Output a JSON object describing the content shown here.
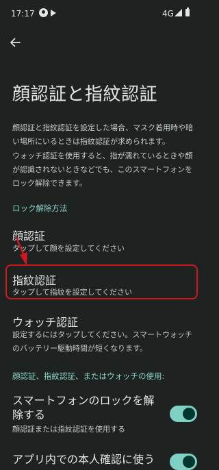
{
  "status_bar": {
    "time": "17:17",
    "network": "4G"
  },
  "page": {
    "title": "顔認証と指紋認証",
    "description_1": "顔認証と指紋認証を設定した場合、マスク着用時や暗い場所にいるときは指紋認証が求められます。",
    "description_2": "ウォッチ認証を使用すると、指が濡れているときや顔が認識されないときなどでも、このスマートフォンをロック解除できます。"
  },
  "unlock_methods": {
    "header": "ロック解除方法",
    "face": {
      "title": "顔認証",
      "subtitle": "タップして顔を設定してください"
    },
    "fingerprint": {
      "title": "指紋認証",
      "subtitle": "タップして指紋を設定してください"
    },
    "watch": {
      "title": "ウォッチ認証",
      "subtitle": "設定するにはタップしてください。スマートウォッチのバッテリー駆動時間が短くなります。"
    }
  },
  "usage": {
    "header": "顔認証、指紋認証、またはウォッチの使用:",
    "unlock_phone": {
      "title": "スマートフォンのロックを解除する",
      "subtitle": "顔認証または指紋認証を使用する",
      "enabled": true
    },
    "in_app": {
      "title": "アプリ内での本人確認に使う",
      "enabled": true
    }
  },
  "colors": {
    "background": "#1e2322",
    "accent": "#8bd3c6",
    "toggle_on": "#7fd1c3",
    "annotation": "#d2171c"
  },
  "icons": {
    "back": "arrow-back-icon"
  }
}
